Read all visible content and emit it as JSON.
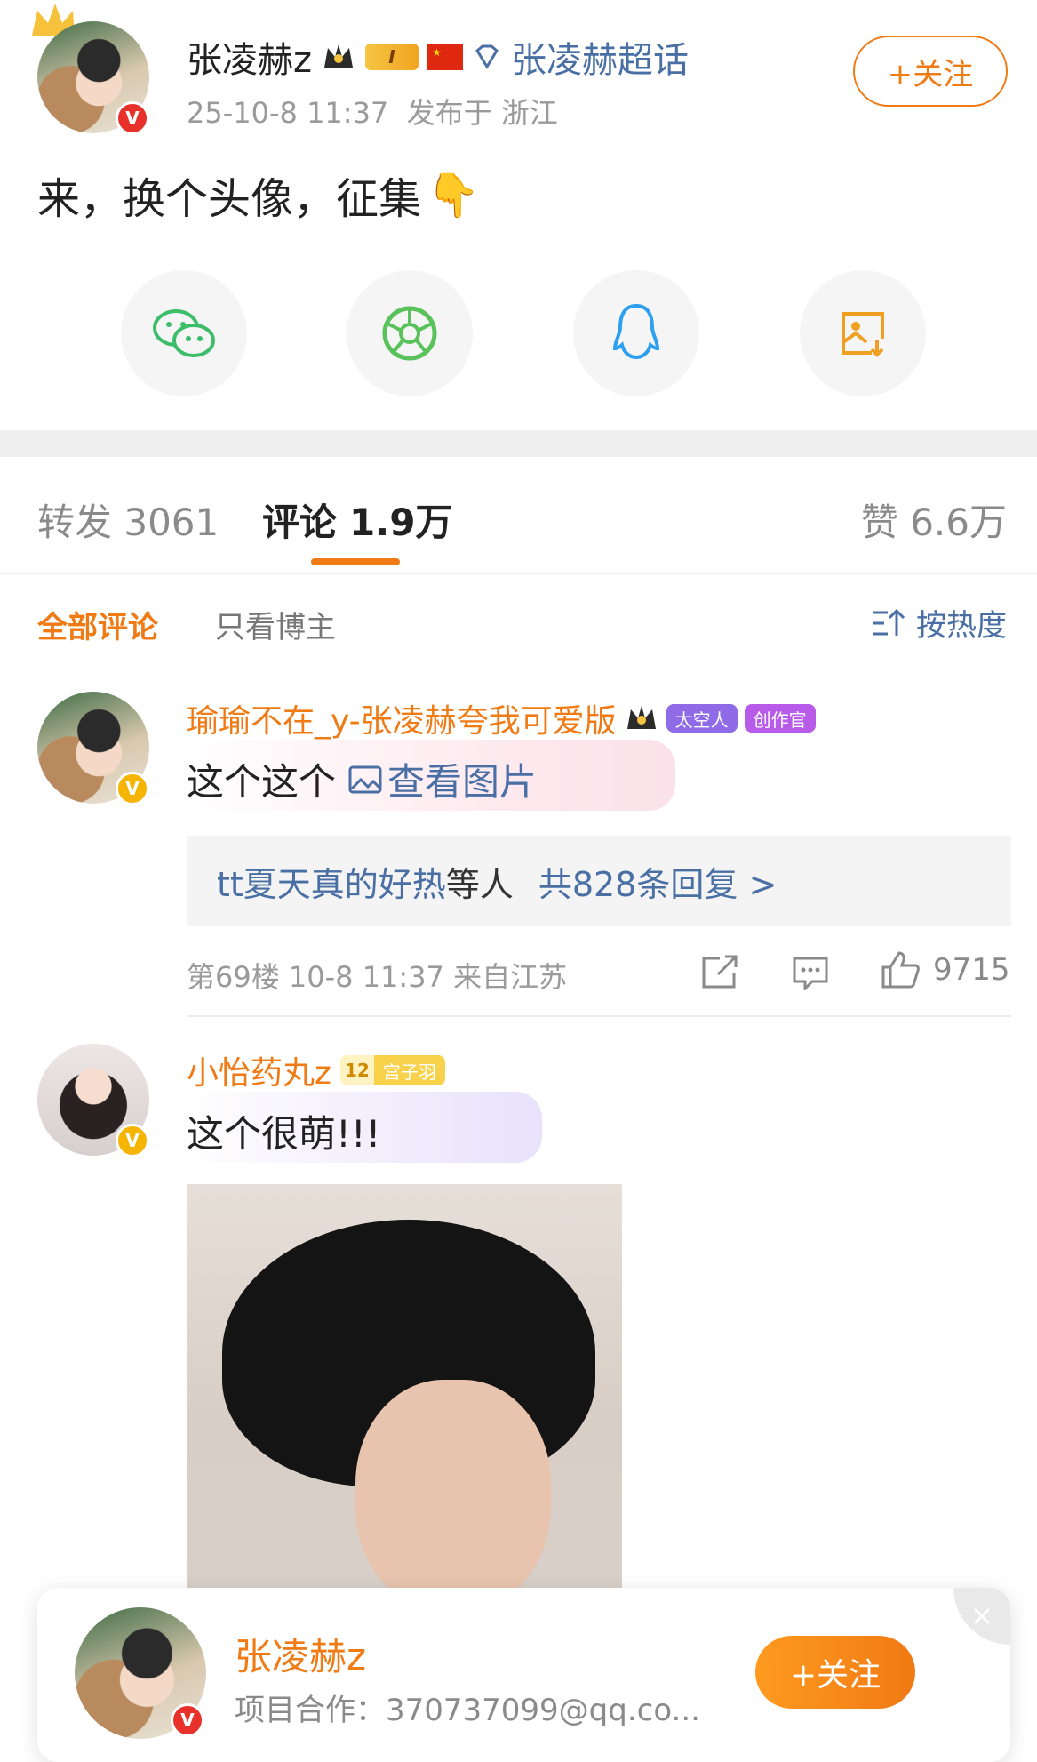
{
  "post": {
    "author_name": "张凌赫z",
    "level_badge": "I",
    "super_topic": "张凌赫超话",
    "meta": "25-10-8 11:37  发布于 浙江",
    "follow_label": "+关注",
    "content": "来，换个头像，征集",
    "emoji": "👇"
  },
  "share_icons": [
    "wechat-icon",
    "moments-icon",
    "qq-icon",
    "save-image-icon"
  ],
  "stats_tabs": {
    "repost": "转发 3061",
    "comments_label": "评论",
    "comments_count": "1.9万",
    "likes": "赞 6.6万"
  },
  "filter": {
    "all": "全部评论",
    "owner_only": "只看博主",
    "sort": "按热度"
  },
  "comments": [
    {
      "username": "瑜瑜不在_y-张凌赫夸我可爱版",
      "badge1": "太空人",
      "badge2": "创作官",
      "text": "这个这个",
      "link_text": "查看图片",
      "reply_user": "tt夏天真的好热",
      "reply_text": "等人",
      "reply_count": "共828条回复 >",
      "meta": "第69楼 10-8 11:37 来自江苏",
      "likes": "9715"
    },
    {
      "username": "小怡药丸z",
      "level": "12",
      "badge": "宫子羽",
      "text": "这个很萌!!!"
    }
  ],
  "follow_card": {
    "name": "张凌赫z",
    "desc": "项目合作：370737099@qq.co...",
    "button": "+关注"
  },
  "colors": {
    "accent_orange": "#f07a14",
    "link_blue": "#4a6fa5",
    "divider": "#f0f0f0"
  }
}
